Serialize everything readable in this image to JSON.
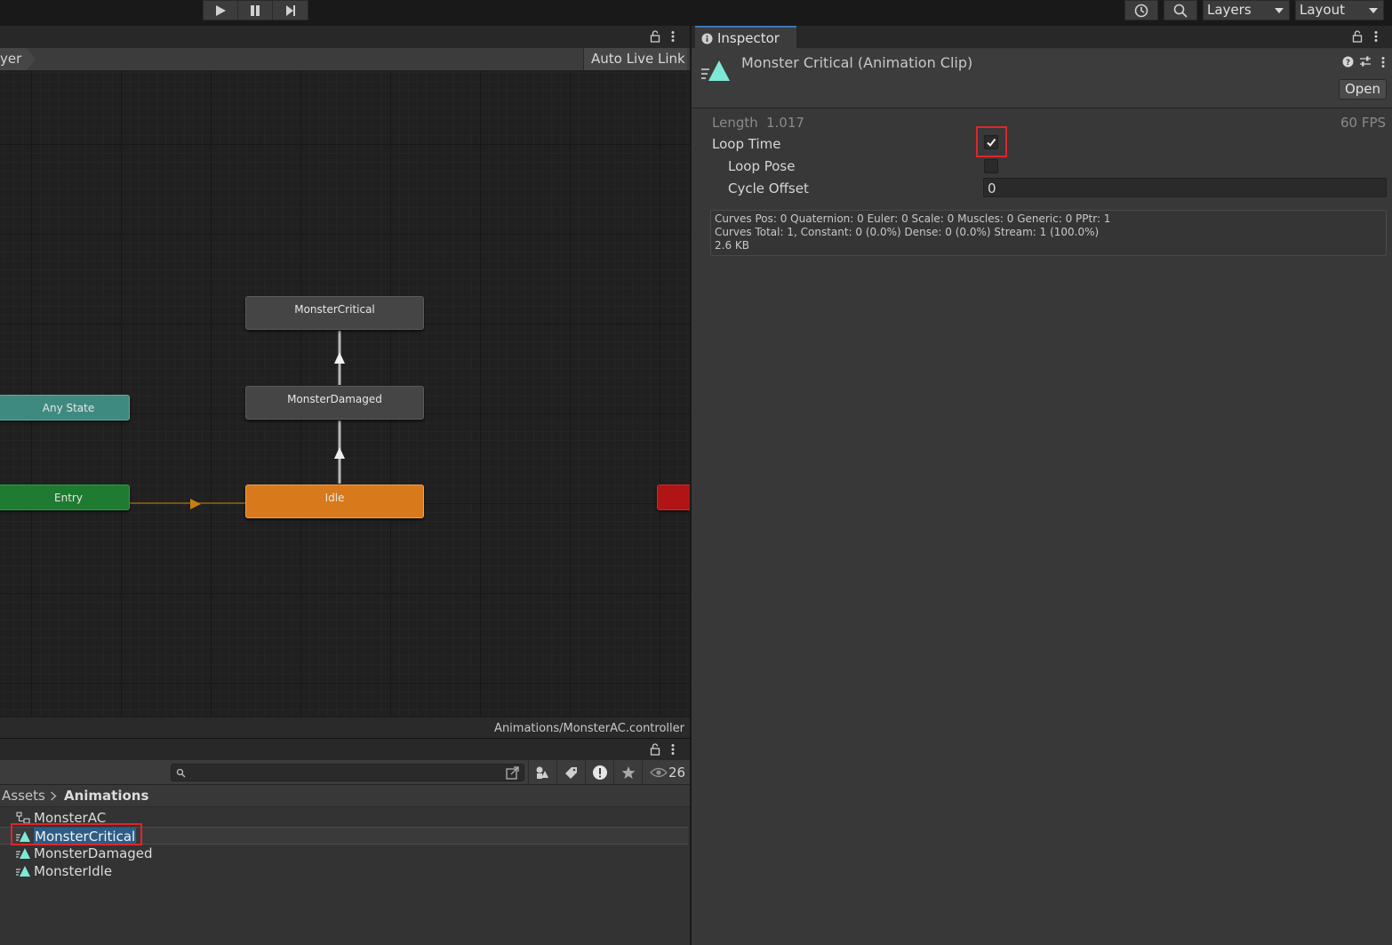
{
  "toolbar": {
    "play_icon": "play-icon",
    "pause_icon": "pause-icon",
    "step_icon": "step-icon",
    "history_icon": "history-icon",
    "search_icon": "search-icon",
    "layers_label": "Layers",
    "layout_label": "Layout"
  },
  "animator": {
    "breadcrumb_partial": "yer",
    "auto_live_link_label": "Auto Live Link",
    "footer_path": "Animations/MonsterAC.controller",
    "nodes": {
      "monster_critical": "MonsterCritical",
      "monster_damaged": "MonsterDamaged",
      "any_state": "Any State",
      "entry": "Entry",
      "idle": "Idle"
    }
  },
  "project": {
    "search_placeholder": "",
    "hidden_count": "26",
    "breadcrumb": {
      "root": "Assets",
      "current": "Animations"
    },
    "assets": [
      {
        "name": "MonsterAC",
        "icon": "animator-controller-icon"
      },
      {
        "name": "MonsterCritical",
        "icon": "animation-clip-icon",
        "selected": true
      },
      {
        "name": "MonsterDamaged",
        "icon": "animation-clip-icon"
      },
      {
        "name": "MonsterIdle",
        "icon": "animation-clip-icon"
      }
    ]
  },
  "inspector": {
    "tab_label": "Inspector",
    "title": "Monster Critical (Animation Clip)",
    "open_button": "Open",
    "length_label": "Length",
    "length_value": "1.017",
    "fps_label": "60 FPS",
    "loop_time_label": "Loop Time",
    "loop_time_checked": true,
    "loop_pose_label": "Loop Pose",
    "loop_pose_checked": false,
    "cycle_offset_label": "Cycle Offset",
    "cycle_offset_value": "0",
    "info_lines": [
      "Curves Pos: 0 Quaternion: 0 Euler: 0 Scale: 0 Muscles: 0 Generic: 0 PPtr: 1",
      "Curves Total: 1, Constant: 0 (0.0%) Dense: 0 (0.0%) Stream: 1 (100.0%)",
      "2.6 KB"
    ]
  },
  "colors": {
    "highlight_red": "#e0252b",
    "idle_node": "#d8791c",
    "entry_node": "#1f7a32",
    "any_state_node": "#3f8a80",
    "exit_node": "#b01414",
    "selection_blue": "#2c5d87",
    "clip_icon_teal": "#7ee8d6"
  }
}
